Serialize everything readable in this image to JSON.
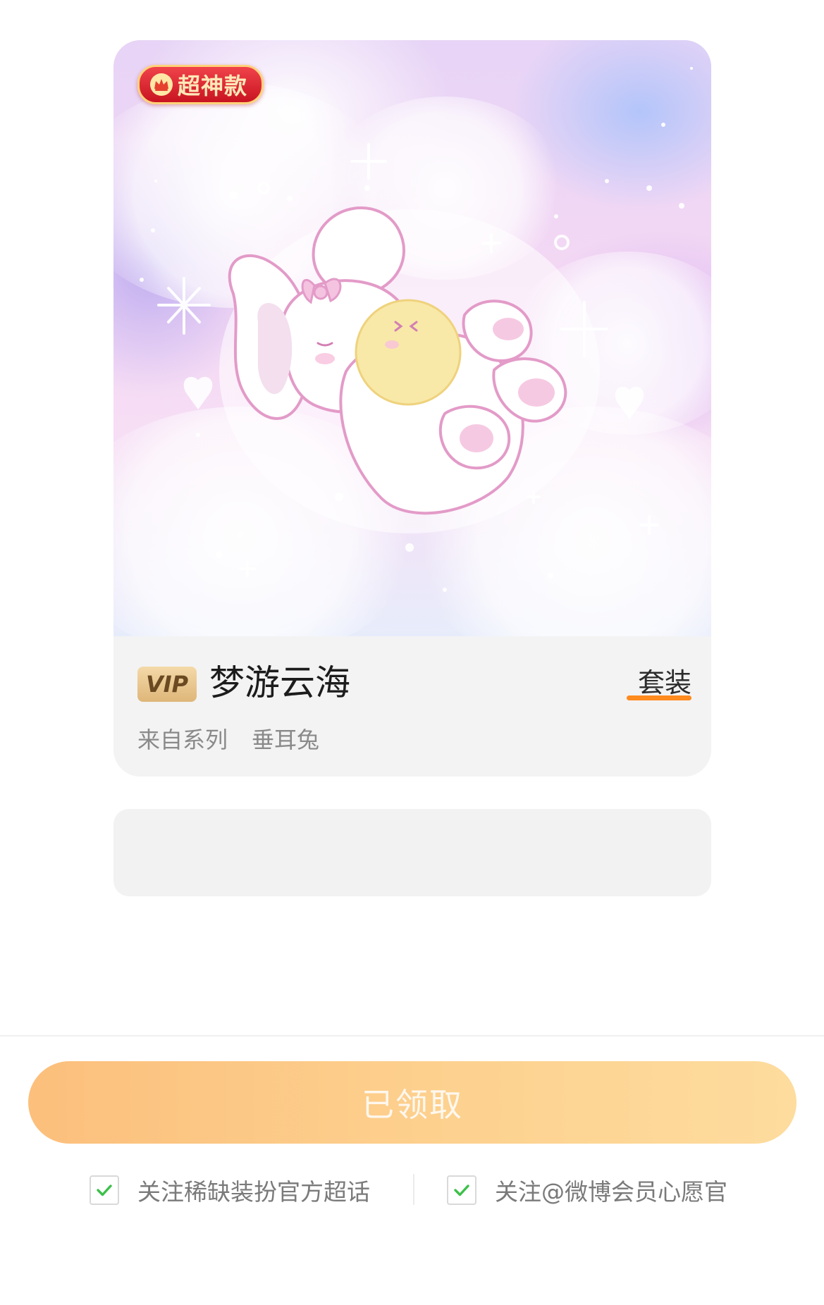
{
  "card": {
    "badge_label": "超神款",
    "badge_icon": "crown-icon",
    "vip_label": "VIP",
    "title": "梦游云海",
    "type_label": "套装",
    "series_label": "来自系列",
    "series_name": "垂耳兔"
  },
  "footer": {
    "claim_button_label": "已领取",
    "checkboxes": [
      {
        "label": "关注稀缺装扮官方超话",
        "checked": true
      },
      {
        "label": "关注@微博会员心愿官",
        "checked": true
      }
    ]
  },
  "colors": {
    "accent_orange": "#ff8a1e",
    "badge_red": "#d61f2c",
    "check_green": "#3cc04a",
    "button_gradient_start": "#fcbf7c",
    "button_gradient_end": "#fddc9e"
  }
}
